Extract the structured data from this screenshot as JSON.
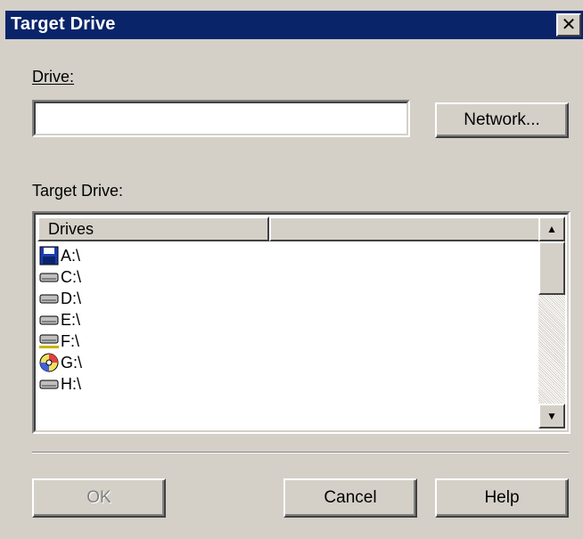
{
  "window": {
    "title": "Target Drive",
    "close_glyph": "✕"
  },
  "drive_field": {
    "label": "Drive:",
    "value": ""
  },
  "network_button": {
    "label": "Network..."
  },
  "target_drive_label": "Target Drive:",
  "drives_list": {
    "columns": [
      "Drives",
      ""
    ],
    "items": [
      {
        "label": "A:\\",
        "icon": "floppy-icon"
      },
      {
        "label": "C:\\",
        "icon": "hard-drive-icon"
      },
      {
        "label": "D:\\",
        "icon": "hard-drive-icon"
      },
      {
        "label": "E:\\",
        "icon": "hard-drive-icon"
      },
      {
        "label": "F:\\",
        "icon": "network-drive-icon"
      },
      {
        "label": "G:\\",
        "icon": "cd-drive-icon"
      },
      {
        "label": "H:\\",
        "icon": "network-drive-icon"
      }
    ]
  },
  "buttons": {
    "ok": "OK",
    "cancel": "Cancel",
    "help": "Help"
  },
  "colors": {
    "titlebar": "#0a246a",
    "face": "#d4d0c8"
  }
}
